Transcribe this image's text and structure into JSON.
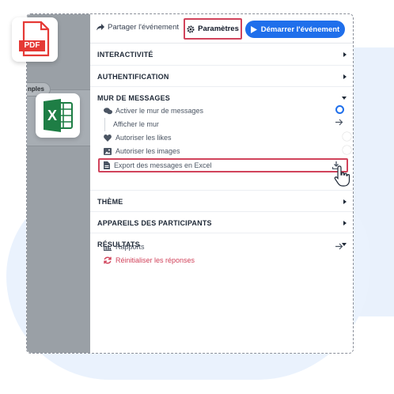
{
  "toolbar": {
    "share_label": "Partager l'événement",
    "params_label": "Paramètres",
    "start_label": "Démarrer l'événement"
  },
  "left": {
    "tab_label": "nples"
  },
  "badges": {
    "pdf": "PDF",
    "excel": "X"
  },
  "sections": {
    "interactivity": "INTERACTIVITÉ",
    "auth": "AUTHENTIFICATION",
    "wall": "MUR DE MESSAGES",
    "theme": "THÈME",
    "devices": "APPAREILS DES PARTICIPANTS",
    "results": "RÉSULTATS"
  },
  "wall_items": {
    "enable": "Activer le mur de messages",
    "show": "Afficher le mur",
    "likes": "Autoriser les likes",
    "images": "Autoriser les images",
    "export": "Export des messages en Excel"
  },
  "toggles": {
    "enable": true,
    "likes": false,
    "images": false
  },
  "results_items": {
    "reports": "Rapports",
    "reset": "Réinitialiser les réponses"
  },
  "colors": {
    "accent": "#1f6feb",
    "danger": "#d1435b",
    "pdf": "#e53935",
    "excel": "#1e7e45"
  }
}
